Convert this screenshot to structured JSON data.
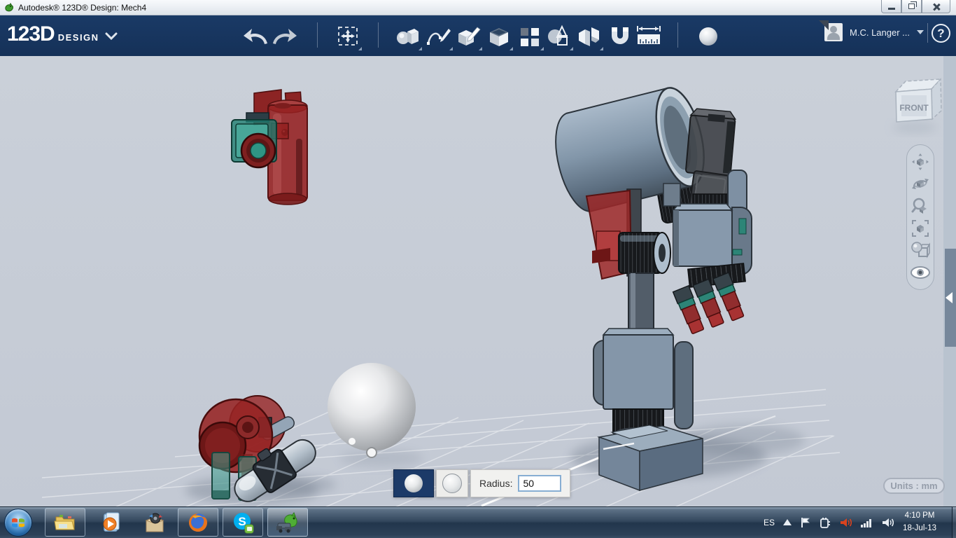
{
  "window": {
    "title": "Autodesk® 123D® Design: Mech4",
    "controls": {
      "minimize": "minimize",
      "restore": "restore",
      "close": "close"
    }
  },
  "appbar": {
    "logo_main": "123D",
    "logo_sub": "DESIGN",
    "account_name": "M.C. Langer ...",
    "help_label": "?",
    "toolbar_icons": [
      "undo",
      "redo",
      "transform",
      "primitives",
      "sketch",
      "construct",
      "modify",
      "pattern",
      "combine",
      "split",
      "snap",
      "measure",
      "sphere-current-tool"
    ]
  },
  "viewport": {
    "viewcube_label": "FRONT",
    "units_label": "Units : mm",
    "nav_icons": [
      "pan",
      "orbit",
      "zoom",
      "fit",
      "shaded-view",
      "visibility"
    ],
    "options": {
      "sphere_solid": "solid-sphere",
      "sphere_hollow": "hollow-sphere",
      "radius_label": "Radius:",
      "radius_value": "50"
    },
    "scene_objects": [
      "red-canister-with-camera",
      "robot-assembly",
      "gray-sphere-preview",
      "red-joint-with-teal-legs",
      "gray-capsule"
    ]
  },
  "taskbar": {
    "apps": [
      "start",
      "explorer",
      "media-player",
      "box-app",
      "firefox",
      "skype",
      "123d-design"
    ],
    "tray": {
      "language": "ES",
      "icons": [
        "hidden-icons",
        "action-center-flag",
        "power-plug",
        "volume-alert",
        "network-signal",
        "volume"
      ],
      "time": "4:10 PM",
      "date": "18-Jul-13"
    }
  },
  "colors": {
    "toolbar_navy": "#17365d",
    "viewport_bg": "#c7cdd7",
    "selected_navy": "#1c3a68",
    "model_red": "#9b2424",
    "model_teal": "#2d8577",
    "model_steel": "#8496a9"
  }
}
